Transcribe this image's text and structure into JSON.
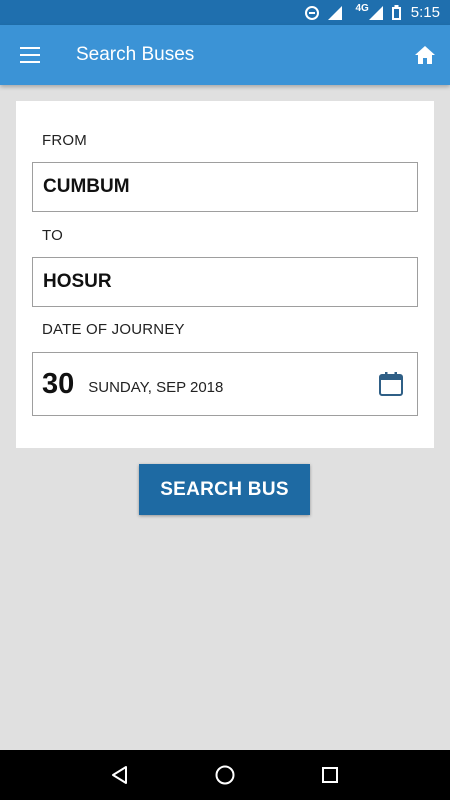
{
  "status_bar": {
    "network": "4G",
    "time": "5:15"
  },
  "app_bar": {
    "title": "Search Buses",
    "menu_icon": "hamburger-menu-icon",
    "home_icon": "home-icon"
  },
  "form": {
    "from_label": "FROM",
    "from_value": "CUMBUM",
    "to_label": "TO",
    "to_value": "HOSUR",
    "date_label": "DATE OF JOURNEY",
    "date_day": "30",
    "date_rest": "SUNDAY, SEP 2018",
    "calendar_icon": "calendar-icon"
  },
  "actions": {
    "search_label": "SEARCH BUS"
  },
  "colors": {
    "status_bar": "#1f6fae",
    "app_bar": "#3b93d6",
    "button": "#1e6aa3",
    "background": "#e0e0e0"
  },
  "nav_bar": {
    "back_icon": "back-triangle-icon",
    "home_icon": "home-circle-icon",
    "recents_icon": "recents-square-icon"
  }
}
